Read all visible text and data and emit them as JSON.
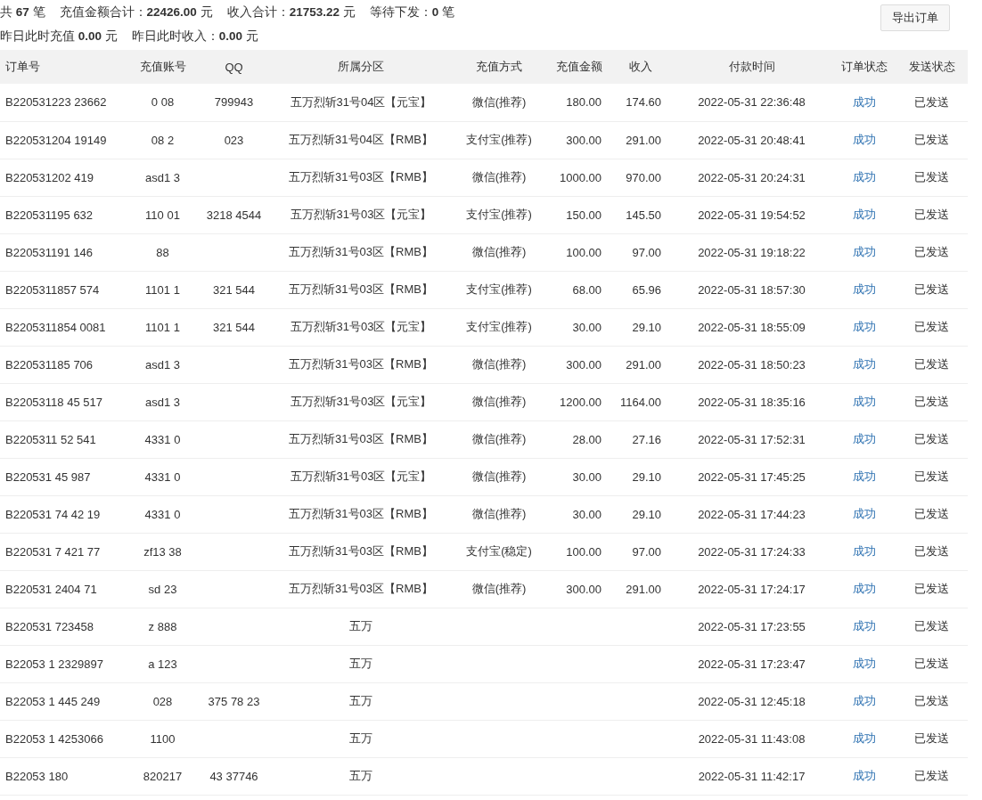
{
  "summary": {
    "lines": [
      [
        "共 **67** 笔",
        "充值金额合计：**22426.00** 元",
        "收入合计：**21753.22** 元",
        "等待下发：**0** 笔"
      ],
      [
        "昨日此时充值 **0.00** 元",
        "昨日此时收入：**0.00** 元"
      ]
    ],
    "export_button": "导出订单"
  },
  "table": {
    "columns": [
      "订单号",
      "充值账号",
      "QQ",
      "所属分区",
      "充值方式",
      "充值金额",
      "收入",
      "付款时间",
      "订单状态",
      "发送状态"
    ],
    "rows": [
      [
        "B220531223 23662",
        "0 08",
        "799943",
        "五万烈斩31号04区【元宝】",
        "微信(推荐)",
        "180.00",
        "174.60",
        "2022-05-31 22:36:48",
        "成功",
        "已发送"
      ],
      [
        "B220531204 19149",
        "08 2",
        "023",
        "五万烈斩31号04区【RMB】",
        "支付宝(推荐)",
        "300.00",
        "291.00",
        "2022-05-31 20:48:41",
        "成功",
        "已发送"
      ],
      [
        "B220531202 419",
        "asd1 3",
        "",
        "五万烈斩31号03区【RMB】",
        "微信(推荐)",
        "1000.00",
        "970.00",
        "2022-05-31 20:24:31",
        "成功",
        "已发送"
      ],
      [
        "B220531195 632",
        "110 01",
        "3218 4544",
        "五万烈斩31号03区【元宝】",
        "支付宝(推荐)",
        "150.00",
        "145.50",
        "2022-05-31 19:54:52",
        "成功",
        "已发送"
      ],
      [
        "B220531191 146",
        "88",
        "",
        "五万烈斩31号03区【RMB】",
        "微信(推荐)",
        "100.00",
        "97.00",
        "2022-05-31 19:18:22",
        "成功",
        "已发送"
      ],
      [
        "B2205311857 574",
        "1101 1",
        "321 544",
        "五万烈斩31号03区【RMB】",
        "支付宝(推荐)",
        "68.00",
        "65.96",
        "2022-05-31 18:57:30",
        "成功",
        "已发送"
      ],
      [
        "B2205311854 0081",
        "1101 1",
        "321 544",
        "五万烈斩31号03区【元宝】",
        "支付宝(推荐)",
        "30.00",
        "29.10",
        "2022-05-31 18:55:09",
        "成功",
        "已发送"
      ],
      [
        "B220531185 706",
        "asd1 3",
        "",
        "五万烈斩31号03区【RMB】",
        "微信(推荐)",
        "300.00",
        "291.00",
        "2022-05-31 18:50:23",
        "成功",
        "已发送"
      ],
      [
        "B22053118 45 517",
        "asd1 3",
        "",
        "五万烈斩31号03区【元宝】",
        "微信(推荐)",
        "1200.00",
        "1164.00",
        "2022-05-31 18:35:16",
        "成功",
        "已发送"
      ],
      [
        "B2205311 52 541",
        "4331 0",
        "",
        "五万烈斩31号03区【RMB】",
        "微信(推荐)",
        "28.00",
        "27.16",
        "2022-05-31 17:52:31",
        "成功",
        "已发送"
      ],
      [
        "B220531 45 987",
        "4331 0",
        "",
        "五万烈斩31号03区【元宝】",
        "微信(推荐)",
        "30.00",
        "29.10",
        "2022-05-31 17:45:25",
        "成功",
        "已发送"
      ],
      [
        "B220531 74 42 19",
        "4331 0",
        "",
        "五万烈斩31号03区【RMB】",
        "微信(推荐)",
        "30.00",
        "29.10",
        "2022-05-31 17:44:23",
        "成功",
        "已发送"
      ],
      [
        "B220531 7 421 77",
        "zf13 38",
        "",
        "五万烈斩31号03区【RMB】",
        "支付宝(稳定)",
        "100.00",
        "97.00",
        "2022-05-31 17:24:33",
        "成功",
        "已发送"
      ],
      [
        "B220531 2404 71",
        "sd 23",
        "",
        "五万烈斩31号03区【RMB】",
        "微信(推荐)",
        "300.00",
        "291.00",
        "2022-05-31 17:24:17",
        "成功",
        "已发送"
      ],
      [
        "B220531 723458",
        "z 888",
        "",
        "五万",
        "",
        "",
        "",
        "2022-05-31 17:23:55",
        "成功",
        "已发送"
      ],
      [
        "B22053 1 2329897",
        "a 123",
        "",
        "五万",
        "",
        "",
        "",
        "2022-05-31 17:23:47",
        "成功",
        "已发送"
      ],
      [
        "B22053 1 445 249",
        "028",
        "375 78 23",
        "五万",
        "",
        "",
        "",
        "2022-05-31 12:45:18",
        "成功",
        "已发送"
      ],
      [
        "B22053 1 4253066",
        "1100",
        "",
        "五万",
        "",
        "",
        "",
        "2022-05-31 11:43:08",
        "成功",
        "已发送"
      ],
      [
        "B22053 180",
        "820217",
        "43 37746",
        "五万",
        "",
        "",
        "",
        "2022-05-31 11:42:17",
        "成功",
        "已发送"
      ]
    ]
  }
}
